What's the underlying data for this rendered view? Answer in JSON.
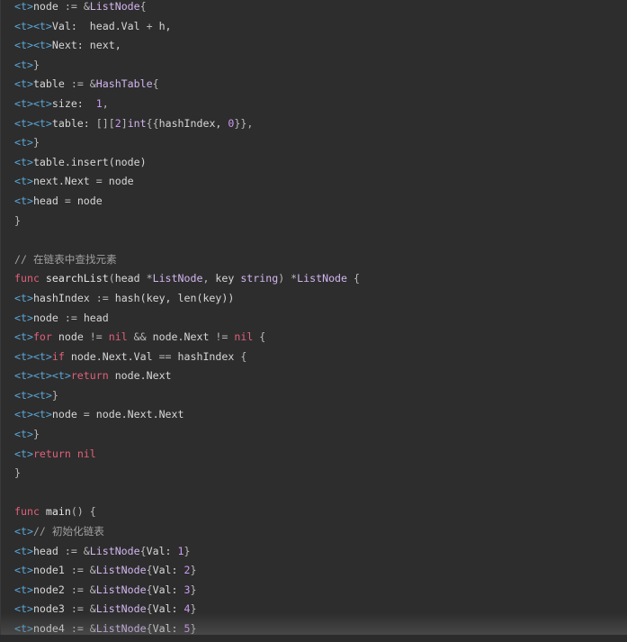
{
  "code_lines": [
    [
      {
        "t": "tok-t",
        "v": "<t>"
      },
      {
        "t": "tok-id",
        "v": "node "
      },
      {
        "t": "tok-op",
        "v": ":= "
      },
      {
        "t": "tok-op",
        "v": "&"
      },
      {
        "t": "tok-ty",
        "v": "ListNode"
      },
      {
        "t": "tok-op",
        "v": "{"
      }
    ],
    [
      {
        "t": "tok-t",
        "v": "<t><t>"
      },
      {
        "t": "tok-id",
        "v": "Val:  head.Val "
      },
      {
        "t": "tok-op",
        "v": "+ "
      },
      {
        "t": "tok-id",
        "v": "h,"
      }
    ],
    [
      {
        "t": "tok-t",
        "v": "<t><t>"
      },
      {
        "t": "tok-id",
        "v": "Next: next,"
      }
    ],
    [
      {
        "t": "tok-t",
        "v": "<t>"
      },
      {
        "t": "tok-op",
        "v": "}"
      }
    ],
    [
      {
        "t": "tok-t",
        "v": "<t>"
      },
      {
        "t": "tok-id",
        "v": "table "
      },
      {
        "t": "tok-op",
        "v": ":= &"
      },
      {
        "t": "tok-ty",
        "v": "HashTable"
      },
      {
        "t": "tok-op",
        "v": "{"
      }
    ],
    [
      {
        "t": "tok-t",
        "v": "<t><t>"
      },
      {
        "t": "tok-id",
        "v": "size:  "
      },
      {
        "t": "tok-num",
        "v": "1"
      },
      {
        "t": "tok-op",
        "v": ","
      }
    ],
    [
      {
        "t": "tok-t",
        "v": "<t><t>"
      },
      {
        "t": "tok-id",
        "v": "table: "
      },
      {
        "t": "tok-op",
        "v": "[]["
      },
      {
        "t": "tok-num",
        "v": "2"
      },
      {
        "t": "tok-op",
        "v": "]"
      },
      {
        "t": "tok-ty",
        "v": "int"
      },
      {
        "t": "tok-op",
        "v": "{{"
      },
      {
        "t": "tok-id",
        "v": "hashIndex, "
      },
      {
        "t": "tok-num",
        "v": "0"
      },
      {
        "t": "tok-op",
        "v": "}},"
      }
    ],
    [
      {
        "t": "tok-t",
        "v": "<t>"
      },
      {
        "t": "tok-op",
        "v": "}"
      }
    ],
    [
      {
        "t": "tok-t",
        "v": "<t>"
      },
      {
        "t": "tok-id",
        "v": "table.insert(node)"
      }
    ],
    [
      {
        "t": "tok-t",
        "v": "<t>"
      },
      {
        "t": "tok-id",
        "v": "next.Next "
      },
      {
        "t": "tok-op",
        "v": "= "
      },
      {
        "t": "tok-id",
        "v": "node"
      }
    ],
    [
      {
        "t": "tok-t",
        "v": "<t>"
      },
      {
        "t": "tok-id",
        "v": "head "
      },
      {
        "t": "tok-op",
        "v": "= "
      },
      {
        "t": "tok-id",
        "v": "node"
      }
    ],
    [
      {
        "t": "tok-op",
        "v": "}"
      }
    ],
    [],
    [
      {
        "t": "tok-com",
        "v": "// 在链表中查找元素"
      }
    ],
    [
      {
        "t": "tok-kw",
        "v": "func "
      },
      {
        "t": "tok-fn",
        "v": "searchList"
      },
      {
        "t": "tok-op",
        "v": "("
      },
      {
        "t": "tok-id",
        "v": "head "
      },
      {
        "t": "tok-op",
        "v": "*"
      },
      {
        "t": "tok-ty",
        "v": "ListNode"
      },
      {
        "t": "tok-op",
        "v": ", "
      },
      {
        "t": "tok-id",
        "v": "key "
      },
      {
        "t": "tok-ty",
        "v": "string"
      },
      {
        "t": "tok-op",
        "v": ") *"
      },
      {
        "t": "tok-ty",
        "v": "ListNode"
      },
      {
        "t": "tok-op",
        "v": " {"
      }
    ],
    [
      {
        "t": "tok-t",
        "v": "<t>"
      },
      {
        "t": "tok-id",
        "v": "hashIndex "
      },
      {
        "t": "tok-op",
        "v": ":= "
      },
      {
        "t": "tok-id",
        "v": "hash(key, len(key))"
      }
    ],
    [
      {
        "t": "tok-t",
        "v": "<t>"
      },
      {
        "t": "tok-id",
        "v": "node "
      },
      {
        "t": "tok-op",
        "v": ":= "
      },
      {
        "t": "tok-id",
        "v": "head"
      }
    ],
    [
      {
        "t": "tok-t",
        "v": "<t>"
      },
      {
        "t": "tok-kw",
        "v": "for "
      },
      {
        "t": "tok-id",
        "v": "node "
      },
      {
        "t": "tok-op",
        "v": "!= "
      },
      {
        "t": "tok-kw",
        "v": "nil "
      },
      {
        "t": "tok-op",
        "v": "&& "
      },
      {
        "t": "tok-id",
        "v": "node.Next "
      },
      {
        "t": "tok-op",
        "v": "!= "
      },
      {
        "t": "tok-kw",
        "v": "nil "
      },
      {
        "t": "tok-op",
        "v": "{"
      }
    ],
    [
      {
        "t": "tok-t",
        "v": "<t><t>"
      },
      {
        "t": "tok-kw",
        "v": "if "
      },
      {
        "t": "tok-id",
        "v": "node.Next.Val "
      },
      {
        "t": "tok-op",
        "v": "== "
      },
      {
        "t": "tok-id",
        "v": "hashIndex "
      },
      {
        "t": "tok-op",
        "v": "{"
      }
    ],
    [
      {
        "t": "tok-t",
        "v": "<t><t><t>"
      },
      {
        "t": "tok-kw",
        "v": "return "
      },
      {
        "t": "tok-id",
        "v": "node.Next"
      }
    ],
    [
      {
        "t": "tok-t",
        "v": "<t><t>"
      },
      {
        "t": "tok-op",
        "v": "}"
      }
    ],
    [
      {
        "t": "tok-t",
        "v": "<t><t>"
      },
      {
        "t": "tok-id",
        "v": "node "
      },
      {
        "t": "tok-op",
        "v": "= "
      },
      {
        "t": "tok-id",
        "v": "node.Next.Next"
      }
    ],
    [
      {
        "t": "tok-t",
        "v": "<t>"
      },
      {
        "t": "tok-op",
        "v": "}"
      }
    ],
    [
      {
        "t": "tok-t",
        "v": "<t>"
      },
      {
        "t": "tok-kw",
        "v": "return "
      },
      {
        "t": "tok-kw",
        "v": "nil"
      }
    ],
    [
      {
        "t": "tok-op",
        "v": "}"
      }
    ],
    [],
    [
      {
        "t": "tok-kw",
        "v": "func "
      },
      {
        "t": "tok-fn",
        "v": "main"
      },
      {
        "t": "tok-op",
        "v": "() {"
      }
    ],
    [
      {
        "t": "tok-t",
        "v": "<t>"
      },
      {
        "t": "tok-com",
        "v": "// 初始化链表"
      }
    ],
    [
      {
        "t": "tok-t",
        "v": "<t>"
      },
      {
        "t": "tok-id",
        "v": "head "
      },
      {
        "t": "tok-op",
        "v": ":= &"
      },
      {
        "t": "tok-ty",
        "v": "ListNode"
      },
      {
        "t": "tok-op",
        "v": "{"
      },
      {
        "t": "tok-id",
        "v": "Val: "
      },
      {
        "t": "tok-num",
        "v": "1"
      },
      {
        "t": "tok-op",
        "v": "}"
      }
    ],
    [
      {
        "t": "tok-t",
        "v": "<t>"
      },
      {
        "t": "tok-id",
        "v": "node1 "
      },
      {
        "t": "tok-op",
        "v": ":= &"
      },
      {
        "t": "tok-ty",
        "v": "ListNode"
      },
      {
        "t": "tok-op",
        "v": "{"
      },
      {
        "t": "tok-id",
        "v": "Val: "
      },
      {
        "t": "tok-num",
        "v": "2"
      },
      {
        "t": "tok-op",
        "v": "}"
      }
    ],
    [
      {
        "t": "tok-t",
        "v": "<t>"
      },
      {
        "t": "tok-id",
        "v": "node2 "
      },
      {
        "t": "tok-op",
        "v": ":= &"
      },
      {
        "t": "tok-ty",
        "v": "ListNode"
      },
      {
        "t": "tok-op",
        "v": "{"
      },
      {
        "t": "tok-id",
        "v": "Val: "
      },
      {
        "t": "tok-num",
        "v": "3"
      },
      {
        "t": "tok-op",
        "v": "}"
      }
    ],
    [
      {
        "t": "tok-t",
        "v": "<t>"
      },
      {
        "t": "tok-id",
        "v": "node3 "
      },
      {
        "t": "tok-op",
        "v": ":= &"
      },
      {
        "t": "tok-ty",
        "v": "ListNode"
      },
      {
        "t": "tok-op",
        "v": "{"
      },
      {
        "t": "tok-id",
        "v": "Val: "
      },
      {
        "t": "tok-num",
        "v": "4"
      },
      {
        "t": "tok-op",
        "v": "}"
      }
    ],
    [
      {
        "t": "tok-t",
        "v": "<t>"
      },
      {
        "t": "tok-id",
        "v": "node4 "
      },
      {
        "t": "tok-op",
        "v": ":= &"
      },
      {
        "t": "tok-ty",
        "v": "ListNode"
      },
      {
        "t": "tok-op",
        "v": "{"
      },
      {
        "t": "tok-id",
        "v": "Val: "
      },
      {
        "t": "tok-num",
        "v": "5"
      },
      {
        "t": "tok-op",
        "v": "}"
      }
    ]
  ],
  "colors": {
    "background": "#2d2d2d",
    "tab_marker": "#5aa7d8",
    "keyword": "#e0607a",
    "type": "#d2b6f0",
    "number": "#ce9bf2",
    "comment": "#a0a0a0"
  }
}
